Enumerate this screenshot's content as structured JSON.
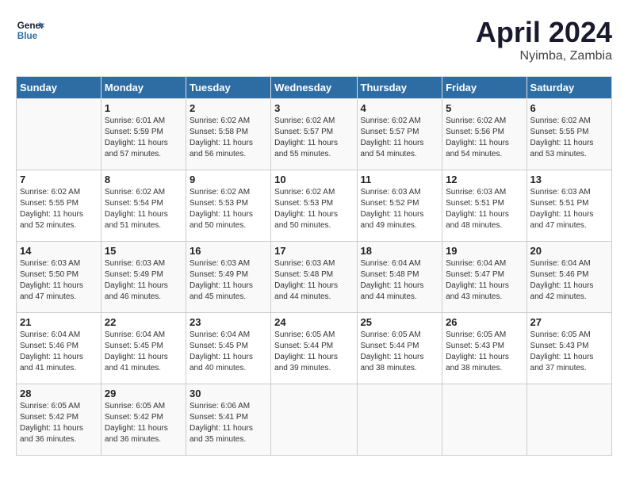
{
  "header": {
    "logo_line1": "General",
    "logo_line2": "Blue",
    "title": "April 2024",
    "subtitle": "Nyimba, Zambia"
  },
  "days_of_week": [
    "Sunday",
    "Monday",
    "Tuesday",
    "Wednesday",
    "Thursday",
    "Friday",
    "Saturday"
  ],
  "weeks": [
    [
      {
        "day": "",
        "info": ""
      },
      {
        "day": "1",
        "info": "Sunrise: 6:01 AM\nSunset: 5:59 PM\nDaylight: 11 hours\nand 57 minutes."
      },
      {
        "day": "2",
        "info": "Sunrise: 6:02 AM\nSunset: 5:58 PM\nDaylight: 11 hours\nand 56 minutes."
      },
      {
        "day": "3",
        "info": "Sunrise: 6:02 AM\nSunset: 5:57 PM\nDaylight: 11 hours\nand 55 minutes."
      },
      {
        "day": "4",
        "info": "Sunrise: 6:02 AM\nSunset: 5:57 PM\nDaylight: 11 hours\nand 54 minutes."
      },
      {
        "day": "5",
        "info": "Sunrise: 6:02 AM\nSunset: 5:56 PM\nDaylight: 11 hours\nand 54 minutes."
      },
      {
        "day": "6",
        "info": "Sunrise: 6:02 AM\nSunset: 5:55 PM\nDaylight: 11 hours\nand 53 minutes."
      }
    ],
    [
      {
        "day": "7",
        "info": "Sunrise: 6:02 AM\nSunset: 5:55 PM\nDaylight: 11 hours\nand 52 minutes."
      },
      {
        "day": "8",
        "info": "Sunrise: 6:02 AM\nSunset: 5:54 PM\nDaylight: 11 hours\nand 51 minutes."
      },
      {
        "day": "9",
        "info": "Sunrise: 6:02 AM\nSunset: 5:53 PM\nDaylight: 11 hours\nand 50 minutes."
      },
      {
        "day": "10",
        "info": "Sunrise: 6:02 AM\nSunset: 5:53 PM\nDaylight: 11 hours\nand 50 minutes."
      },
      {
        "day": "11",
        "info": "Sunrise: 6:03 AM\nSunset: 5:52 PM\nDaylight: 11 hours\nand 49 minutes."
      },
      {
        "day": "12",
        "info": "Sunrise: 6:03 AM\nSunset: 5:51 PM\nDaylight: 11 hours\nand 48 minutes."
      },
      {
        "day": "13",
        "info": "Sunrise: 6:03 AM\nSunset: 5:51 PM\nDaylight: 11 hours\nand 47 minutes."
      }
    ],
    [
      {
        "day": "14",
        "info": "Sunrise: 6:03 AM\nSunset: 5:50 PM\nDaylight: 11 hours\nand 47 minutes."
      },
      {
        "day": "15",
        "info": "Sunrise: 6:03 AM\nSunset: 5:49 PM\nDaylight: 11 hours\nand 46 minutes."
      },
      {
        "day": "16",
        "info": "Sunrise: 6:03 AM\nSunset: 5:49 PM\nDaylight: 11 hours\nand 45 minutes."
      },
      {
        "day": "17",
        "info": "Sunrise: 6:03 AM\nSunset: 5:48 PM\nDaylight: 11 hours\nand 44 minutes."
      },
      {
        "day": "18",
        "info": "Sunrise: 6:04 AM\nSunset: 5:48 PM\nDaylight: 11 hours\nand 44 minutes."
      },
      {
        "day": "19",
        "info": "Sunrise: 6:04 AM\nSunset: 5:47 PM\nDaylight: 11 hours\nand 43 minutes."
      },
      {
        "day": "20",
        "info": "Sunrise: 6:04 AM\nSunset: 5:46 PM\nDaylight: 11 hours\nand 42 minutes."
      }
    ],
    [
      {
        "day": "21",
        "info": "Sunrise: 6:04 AM\nSunset: 5:46 PM\nDaylight: 11 hours\nand 41 minutes."
      },
      {
        "day": "22",
        "info": "Sunrise: 6:04 AM\nSunset: 5:45 PM\nDaylight: 11 hours\nand 41 minutes."
      },
      {
        "day": "23",
        "info": "Sunrise: 6:04 AM\nSunset: 5:45 PM\nDaylight: 11 hours\nand 40 minutes."
      },
      {
        "day": "24",
        "info": "Sunrise: 6:05 AM\nSunset: 5:44 PM\nDaylight: 11 hours\nand 39 minutes."
      },
      {
        "day": "25",
        "info": "Sunrise: 6:05 AM\nSunset: 5:44 PM\nDaylight: 11 hours\nand 38 minutes."
      },
      {
        "day": "26",
        "info": "Sunrise: 6:05 AM\nSunset: 5:43 PM\nDaylight: 11 hours\nand 38 minutes."
      },
      {
        "day": "27",
        "info": "Sunrise: 6:05 AM\nSunset: 5:43 PM\nDaylight: 11 hours\nand 37 minutes."
      }
    ],
    [
      {
        "day": "28",
        "info": "Sunrise: 6:05 AM\nSunset: 5:42 PM\nDaylight: 11 hours\nand 36 minutes."
      },
      {
        "day": "29",
        "info": "Sunrise: 6:05 AM\nSunset: 5:42 PM\nDaylight: 11 hours\nand 36 minutes."
      },
      {
        "day": "30",
        "info": "Sunrise: 6:06 AM\nSunset: 5:41 PM\nDaylight: 11 hours\nand 35 minutes."
      },
      {
        "day": "",
        "info": ""
      },
      {
        "day": "",
        "info": ""
      },
      {
        "day": "",
        "info": ""
      },
      {
        "day": "",
        "info": ""
      }
    ]
  ]
}
